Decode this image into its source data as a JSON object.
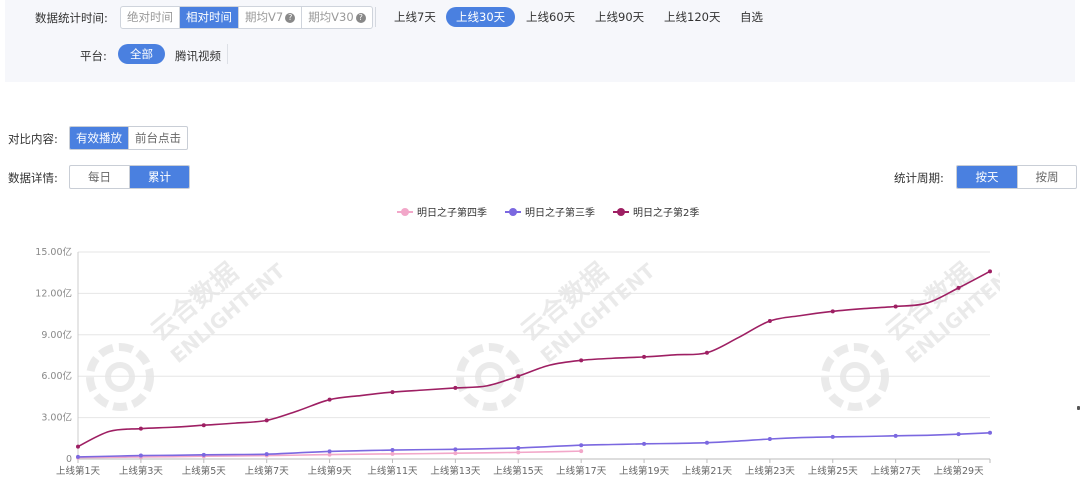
{
  "filters": {
    "time_label": "数据统计时间:",
    "time_modes": [
      {
        "label": "绝对时间",
        "active": false,
        "help": false
      },
      {
        "label": "相对时间",
        "active": true,
        "help": false
      },
      {
        "label": "期均V7",
        "active": false,
        "help": true
      },
      {
        "label": "期均V30",
        "active": false,
        "help": true
      }
    ],
    "ranges": [
      {
        "label": "上线7天",
        "active": false
      },
      {
        "label": "上线30天",
        "active": true
      },
      {
        "label": "上线60天",
        "active": false
      },
      {
        "label": "上线90天",
        "active": false
      },
      {
        "label": "上线120天",
        "active": false
      },
      {
        "label": "自选",
        "active": false
      }
    ],
    "platform_label": "平台:",
    "platforms": [
      {
        "label": "全部",
        "active": true
      },
      {
        "label": "腾讯视频",
        "active": false
      }
    ],
    "help_glyph": "?"
  },
  "compare": {
    "label": "对比内容:",
    "options": [
      {
        "label": "有效播放",
        "active": true
      },
      {
        "label": "前台点击",
        "active": false
      }
    ]
  },
  "detail": {
    "label": "数据详情:",
    "options": [
      {
        "label": "每日",
        "active": false
      },
      {
        "label": "累计",
        "active": true
      }
    ]
  },
  "period": {
    "label": "统计周期:",
    "options": [
      {
        "label": "按天",
        "active": true
      },
      {
        "label": "按周",
        "active": false
      }
    ]
  },
  "watermark": {
    "cn": "云合数据",
    "en": "ENLIGHTENT"
  },
  "chart_data": {
    "type": "line",
    "x": [
      "上线第1天",
      "上线第2天",
      "上线第3天",
      "上线第4天",
      "上线第5天",
      "上线第6天",
      "上线第7天",
      "上线第8天",
      "上线第9天",
      "上线第10天",
      "上线第11天",
      "上线第12天",
      "上线第13天",
      "上线第14天",
      "上线第15天",
      "上线第16天",
      "上线第17天",
      "上线第18天",
      "上线第19天",
      "上线第20天",
      "上线第21天",
      "上线第22天",
      "上线第23天",
      "上线第24天",
      "上线第25天",
      "上线第26天",
      "上线第27天",
      "上线第28天",
      "上线第29天",
      "上线第30天"
    ],
    "x_tick_labels": [
      "上线第1天",
      "上线第3天",
      "上线第5天",
      "上线第7天",
      "上线第9天",
      "上线第11天",
      "上线第13天",
      "上线第15天",
      "上线第17天",
      "上线第19天",
      "上线第21天",
      "上线第23天",
      "上线第25天",
      "上线第27天",
      "上线第29天"
    ],
    "y_ticks": [
      "0",
      "3.00亿",
      "6.00亿",
      "9.00亿",
      "12.00亿",
      "15.00亿"
    ],
    "ylim": [
      0,
      15
    ],
    "y_unit": "亿",
    "grid": true,
    "legend_position": "top-center",
    "series": [
      {
        "name": "明日之子第四季",
        "color": "#f2a7c9",
        "values": [
          0.1,
          0.12,
          0.15,
          0.17,
          0.2,
          0.22,
          0.25,
          0.28,
          0.32,
          0.35,
          0.37,
          0.39,
          0.42,
          0.45,
          0.48,
          0.52,
          0.57
        ]
      },
      {
        "name": "明日之子第三季",
        "color": "#7b68e0",
        "values": [
          0.15,
          0.2,
          0.25,
          0.27,
          0.3,
          0.32,
          0.35,
          0.45,
          0.55,
          0.6,
          0.65,
          0.68,
          0.7,
          0.75,
          0.8,
          0.9,
          1.0,
          1.05,
          1.1,
          1.13,
          1.18,
          1.3,
          1.45,
          1.55,
          1.6,
          1.63,
          1.68,
          1.72,
          1.8,
          1.9
        ]
      },
      {
        "name": "明日之子第2季",
        "color": "#9e1f63",
        "values": [
          0.9,
          2.0,
          2.2,
          2.3,
          2.45,
          2.6,
          2.8,
          3.5,
          4.3,
          4.6,
          4.85,
          5.0,
          5.15,
          5.3,
          6.0,
          6.8,
          7.15,
          7.3,
          7.4,
          7.55,
          7.7,
          8.8,
          10.0,
          10.4,
          10.7,
          10.9,
          11.05,
          11.3,
          12.4,
          13.6
        ]
      }
    ]
  }
}
